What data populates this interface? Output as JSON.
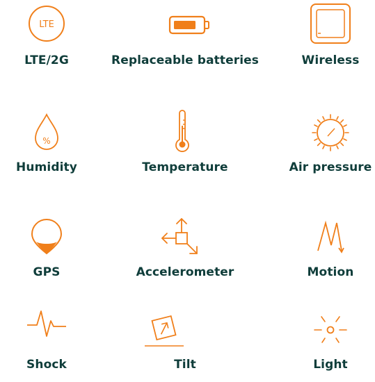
{
  "accent_color": "#f07f1a",
  "text_color": "#0f3d3a",
  "features": [
    {
      "label": "LTE/2G",
      "icon": "lte-circle-icon",
      "icon_text": "LTE"
    },
    {
      "label": "Replaceable batteries",
      "icon": "battery-icon"
    },
    {
      "label": "Wireless",
      "icon": "wireless-square-icon"
    },
    {
      "label": "Humidity",
      "icon": "humidity-drop-icon",
      "icon_text": "%"
    },
    {
      "label": "Temperature",
      "icon": "thermometer-icon"
    },
    {
      "label": "Air pressure",
      "icon": "pressure-gauge-icon"
    },
    {
      "label": "GPS",
      "icon": "gps-pin-icon"
    },
    {
      "label": "Accelerometer",
      "icon": "accelerometer-icon"
    },
    {
      "label": "Motion",
      "icon": "motion-zigzag-icon"
    },
    {
      "label": "Shock",
      "icon": "shock-pulse-icon"
    },
    {
      "label": "Tilt",
      "icon": "tilt-icon"
    },
    {
      "label": "Light",
      "icon": "light-icon"
    }
  ]
}
